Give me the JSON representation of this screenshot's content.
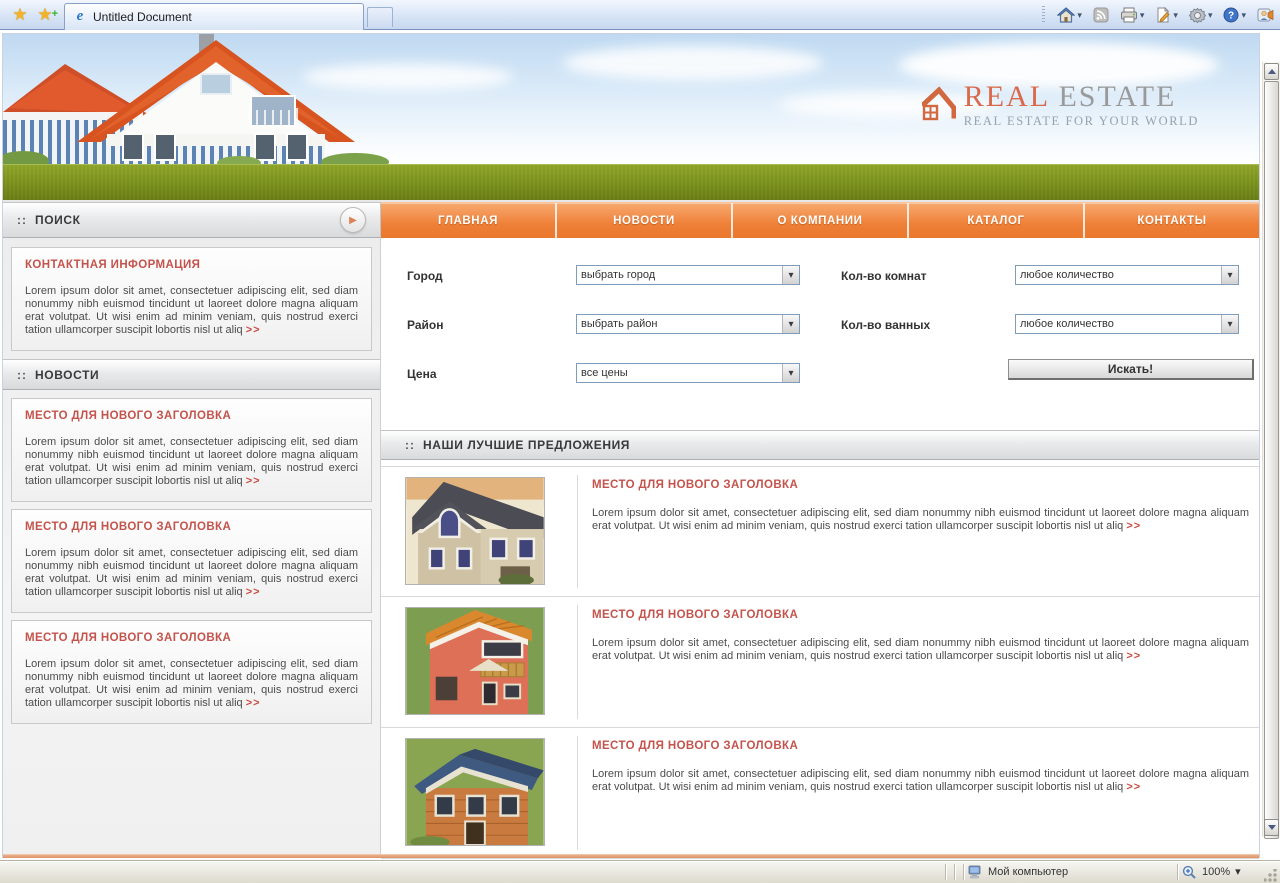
{
  "browser": {
    "tab_title": "Untitled Document"
  },
  "icons": {
    "star": "★",
    "plus": "+",
    "ie_logo": "e",
    "dropdown_arrow": "▾",
    "select_arrow": "▾",
    "play_arrow": "▶",
    "section_marker": "::"
  },
  "logo": {
    "title_accent": "REAL",
    "title_rest": " ESTATE",
    "tagline": "REAL ESTATE FOR YOUR WORLD"
  },
  "nav": {
    "items": [
      {
        "label": "ГЛАВНАЯ"
      },
      {
        "label": "НОВОСТИ"
      },
      {
        "label": "О КОМПАНИИ"
      },
      {
        "label": "КАТАЛОГ"
      },
      {
        "label": "КОНТАКТЫ"
      }
    ]
  },
  "sidebar": {
    "search_header": "ПОИСК",
    "news_header": "НОВОСТИ",
    "contact": {
      "title": "КОНТАКТНАЯ ИНФОРМАЦИЯ",
      "text": "Lorem ipsum dolor sit amet, consectetuer adipiscing elit, sed diam nonummy nibh euismod tincidunt ut laoreet dolore magna aliquam erat volutpat. Ut wisi enim ad minim veniam, quis nostrud exerci tation ullamcorper suscipit lobortis nisl ut aliq ",
      "more": ">>"
    },
    "news": [
      {
        "title": "МЕСТО ДЛЯ НОВОГО ЗАГОЛОВКА",
        "text": "Lorem ipsum dolor sit amet, consectetuer adipiscing elit, sed diam nonummy nibh euismod tincidunt ut laoreet dolore magna aliquam erat volutpat. Ut wisi enim ad minim veniam, quis nostrud exerci tation ullamcorper suscipit lobortis nisl ut aliq ",
        "more": ">>"
      },
      {
        "title": "МЕСТО ДЛЯ НОВОГО ЗАГОЛОВКА",
        "text": "Lorem ipsum dolor sit amet, consectetuer adipiscing elit, sed diam nonummy nibh euismod tincidunt ut laoreet dolore magna aliquam erat volutpat. Ut wisi enim ad minim veniam, quis nostrud exerci tation ullamcorper suscipit lobortis nisl ut aliq ",
        "more": ">>"
      },
      {
        "title": "МЕСТО ДЛЯ НОВОГО ЗАГОЛОВКА",
        "text": "Lorem ipsum dolor sit amet, consectetuer adipiscing elit, sed diam nonummy nibh euismod tincidunt ut laoreet dolore magna aliquam erat volutpat. Ut wisi enim ad minim veniam, quis nostrud exerci tation ullamcorper suscipit lobortis nisl ut aliq ",
        "more": ">>"
      }
    ]
  },
  "search_form": {
    "left_fields": [
      {
        "label": "Город",
        "value": "выбрать город"
      },
      {
        "label": "Район",
        "value": "выбрать район"
      },
      {
        "label": "Цена",
        "value": "все цены"
      }
    ],
    "right_fields": [
      {
        "label": "Кол-во комнат",
        "value": "любое количество"
      },
      {
        "label": "Кол-во ванных",
        "value": "любое количество"
      }
    ],
    "submit_label": "Искать!"
  },
  "offers": {
    "header": "НАШИ ЛУЧШИЕ ПРЕДЛОЖЕНИЯ",
    "items": [
      {
        "title": "МЕСТО ДЛЯ НОВОГО ЗАГОЛОВКА",
        "text": "Lorem ipsum dolor sit amet, consectetuer adipiscing elit, sed diam nonummy nibh euismod tincidunt ut laoreet dolore magna aliquam erat volutpat. Ut wisi enim ad minim veniam, quis nostrud exerci tation ullamcorper suscipit lobortis nisl ut aliq ",
        "more": ">>"
      },
      {
        "title": "МЕСТО ДЛЯ НОВОГО ЗАГОЛОВКА",
        "text": "Lorem ipsum dolor sit amet, consectetuer adipiscing elit, sed diam nonummy nibh euismod tincidunt ut laoreet dolore magna aliquam erat volutpat. Ut wisi enim ad minim veniam, quis nostrud exerci tation ullamcorper suscipit lobortis nisl ut aliq ",
        "more": ">>"
      },
      {
        "title": "МЕСТО ДЛЯ НОВОГО ЗАГОЛОВКА",
        "text": "Lorem ipsum dolor sit amet, consectetuer adipiscing elit, sed diam nonummy nibh euismod tincidunt ut laoreet dolore magna aliquam erat volutpat. Ut wisi enim ad minim veniam, quis nostrud exerci tation ullamcorper suscipit lobortis nisl ut aliq ",
        "more": ">>"
      }
    ]
  },
  "statusbar": {
    "zone_label": "Мой компьютер",
    "zoom_value": "100%"
  },
  "colors": {
    "nav_orange": "#ef8038",
    "title_red": "#c4534c",
    "grass_green": "#7d941f",
    "logo_accent": "#d9694a"
  }
}
